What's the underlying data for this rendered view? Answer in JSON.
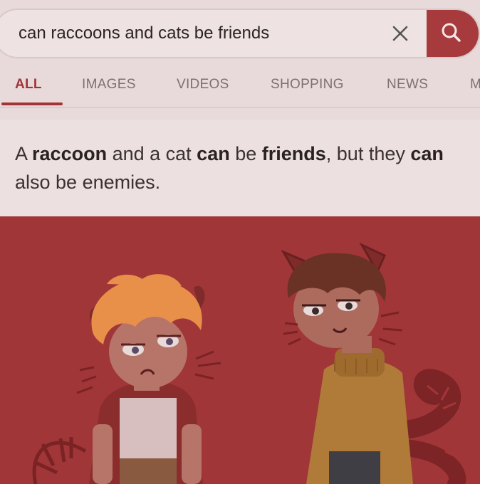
{
  "search": {
    "query": "can raccoons and cats be friends",
    "clear_icon": "close-icon",
    "submit_icon": "search-icon"
  },
  "tabs": [
    {
      "label": "ALL",
      "active": true
    },
    {
      "label": "IMAGES",
      "active": false
    },
    {
      "label": "VIDEOS",
      "active": false
    },
    {
      "label": "SHOPPING",
      "active": false
    },
    {
      "label": "NEWS",
      "active": false
    },
    {
      "label": "M",
      "active": false
    }
  ],
  "answer": {
    "p1": "A ",
    "b1": "raccoon",
    "p2": " and a cat ",
    "b2": "can",
    "p3": " be ",
    "b3": "friends",
    "p4": ", but they ",
    "b4": "can",
    "p5": " also be enemies."
  },
  "colors": {
    "accent": "#a63a3c",
    "background": "#e8dada",
    "illustration_bg": "#a13638"
  }
}
